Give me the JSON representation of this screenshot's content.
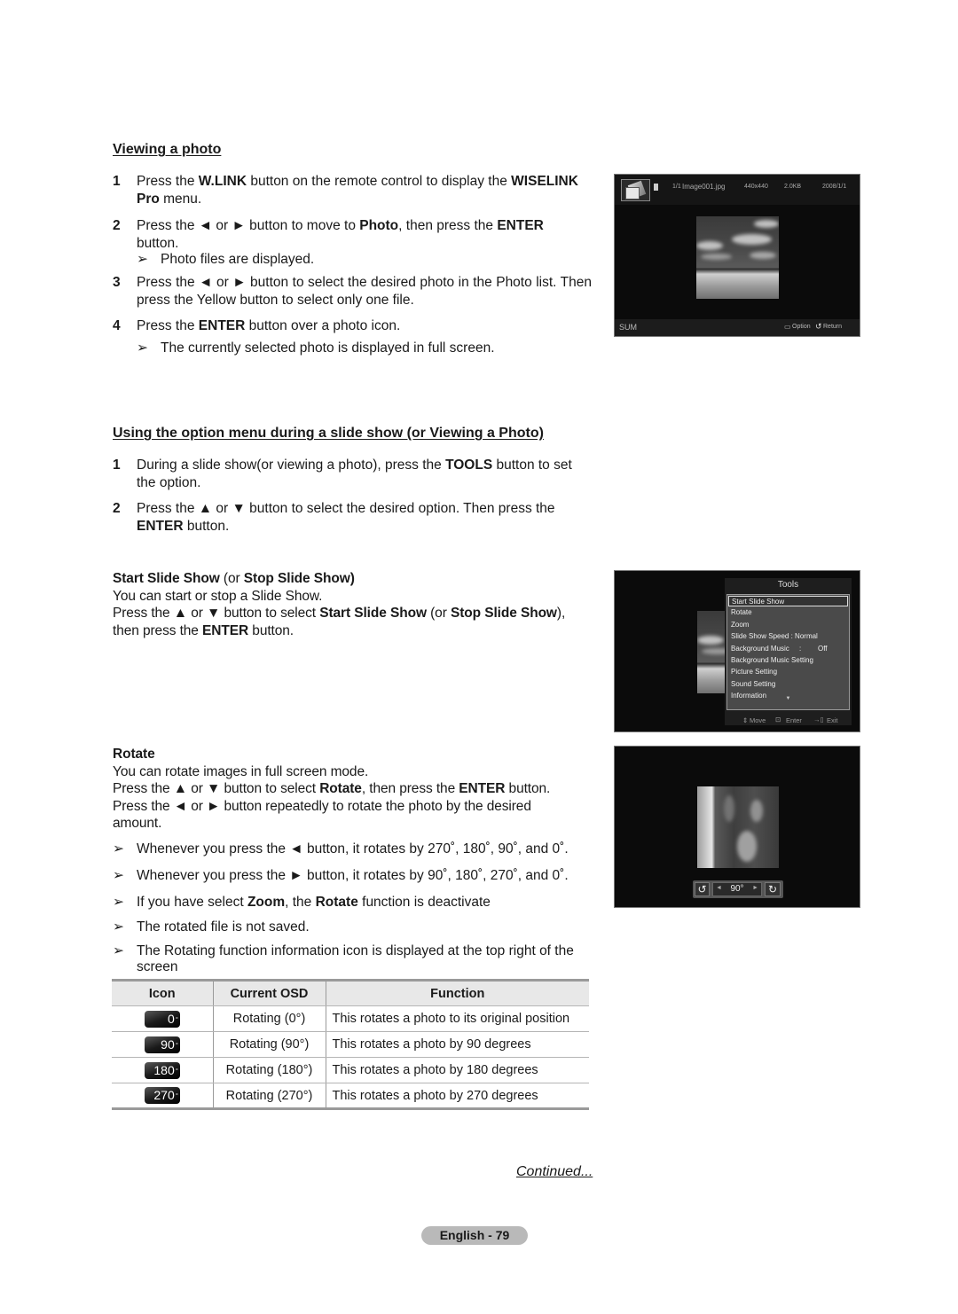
{
  "section1": {
    "title": "Viewing a photo",
    "steps": [
      {
        "num": "1",
        "parts": [
          "Press the ",
          "W.LINK",
          " button on the remote control to display the ",
          "WISELINK Pro",
          " menu."
        ]
      },
      {
        "num": "2",
        "parts": [
          "Press the ◄ or ► button to move to ",
          "Photo",
          ", then press the ",
          "ENTER",
          " button."
        ],
        "note": "Photo files are displayed."
      },
      {
        "num": "3",
        "text": "Press the ◄ or ► button to select the desired photo in the Photo list. Then press the Yellow button to select only one file."
      },
      {
        "num": "4",
        "parts": [
          "Press the ",
          "ENTER",
          " button over a photo icon."
        ],
        "note": "The currently selected photo is displayed in full screen."
      }
    ]
  },
  "screen1": {
    "file_index": "1/1",
    "file_name": "Image001.jpg",
    "resolution": "440x440",
    "size": "2.0KB",
    "date": "2008/1/1",
    "device": "SUM",
    "option_label": "Option",
    "return_label": "Return"
  },
  "section2": {
    "title": "Using the option menu during a slide show (or Viewing a Photo)",
    "steps": [
      {
        "num": "1",
        "parts": [
          "During a slide show(or viewing a photo), press the ",
          "TOOLS",
          " button to set the option."
        ]
      },
      {
        "num": "2",
        "parts": [
          "Press the ▲ or ▼ button to select the desired option. Then press the ",
          "ENTER",
          " button."
        ]
      }
    ]
  },
  "slideshow": {
    "heading_a": "Start Slide Show",
    "heading_mid": " (or ",
    "heading_b": "Stop Slide Show",
    "heading_end": ")",
    "line1": "You can start or stop a Slide Show.",
    "line2_parts": [
      "Press the ▲ or ▼ button to select ",
      "Start Slide Show",
      " (or ",
      "Stop Slide Show",
      "),"
    ],
    "line3_parts": [
      "then press the ",
      "ENTER",
      " button."
    ]
  },
  "tools_menu": {
    "title": "Tools",
    "items": [
      {
        "label": "Start Slide Show",
        "selected": true
      },
      {
        "label": "Rotate"
      },
      {
        "label": "Zoom"
      },
      {
        "label": "Slide Show Speed : Normal"
      },
      {
        "label": "Background Music",
        "value_sep": ":",
        "value": "Off"
      },
      {
        "label": "Background Music Setting"
      },
      {
        "label": "Picture Setting"
      },
      {
        "label": "Sound Setting"
      },
      {
        "label": "Information"
      }
    ],
    "footer": {
      "move": "Move",
      "enter": "Enter",
      "exit": "Exit"
    }
  },
  "rotate": {
    "heading": "Rotate",
    "line1": "You can rotate images in full screen mode.",
    "line2_parts": [
      "Press the ▲ or ▼ button to select ",
      "Rotate",
      ", then press the ",
      "ENTER",
      " button."
    ],
    "line3": "Press the ◄ or ► button repeatedly to rotate the photo by the desired amount.",
    "notes": [
      {
        "text": "Whenever you press the ◄ button, it rotates by 270˚, 180˚, 90˚, and 0˚."
      },
      {
        "text": "Whenever you press the ► button, it rotates by 90˚, 180˚, 270˚, and 0˚."
      },
      {
        "parts": [
          "If you have select ",
          "Zoom",
          ", the ",
          "Rotate",
          " function is deactivate"
        ]
      },
      {
        "text": "The rotated file is not saved."
      },
      {
        "text": "The Rotating function information icon is displayed at the top right of the screen"
      }
    ],
    "osd_value": "90°"
  },
  "table": {
    "headers": [
      "Icon",
      "Current OSD",
      "Function"
    ],
    "rows": [
      {
        "icon": "0",
        "osd": "Rotating (0°)",
        "function": "This rotates a photo to its original position"
      },
      {
        "icon": "90",
        "osd": "Rotating (90°)",
        "function": "This rotates a photo by 90 degrees"
      },
      {
        "icon": "180",
        "osd": "Rotating (180°)",
        "function": "This rotates a photo by 180 degrees"
      },
      {
        "icon": "270",
        "osd": "Rotating (270°)",
        "function": "This rotates a photo by 270 degrees"
      }
    ]
  },
  "footer": {
    "continued": "Continued...",
    "page": "English - 79"
  }
}
